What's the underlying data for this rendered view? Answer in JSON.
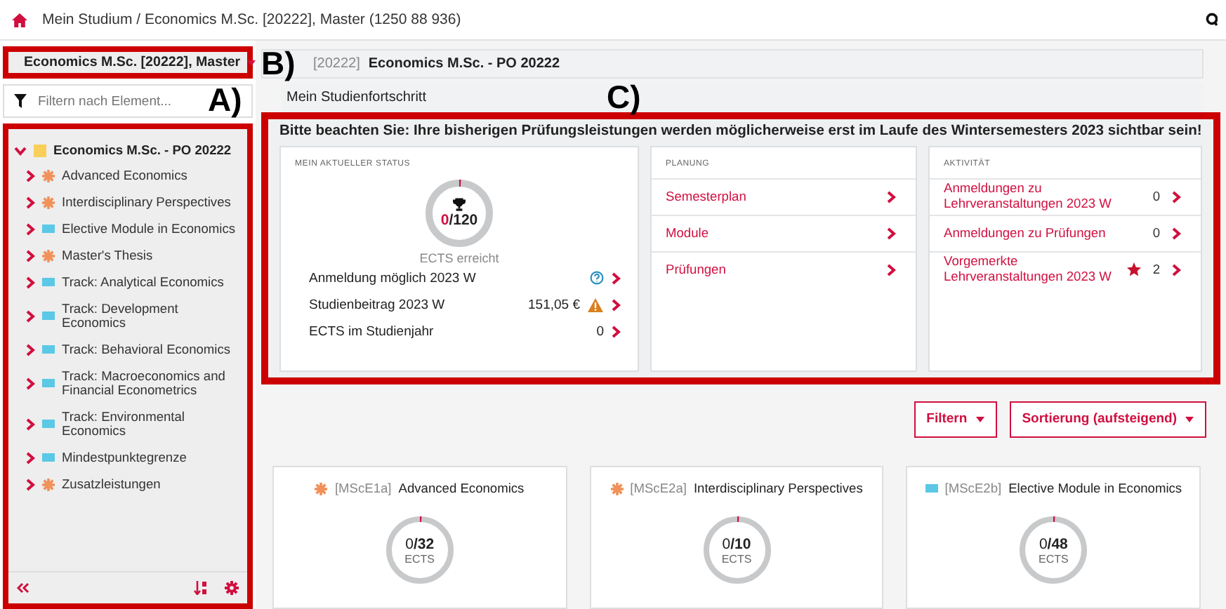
{
  "top_bar": {
    "breadcrumb": "Mein Studium / Economics M.Sc. [20222], Master (1250 88 936)"
  },
  "annotations": [
    {
      "label": "A)"
    },
    {
      "label": "B)"
    },
    {
      "label": "C)"
    }
  ],
  "sidebar": {
    "program_selector": "Economics M.Sc. [20222], Master",
    "filter": {
      "placeholder": "Filtern nach Element..."
    },
    "tree": [
      {
        "label": "Economics M.Sc. - PO 20222",
        "kind": "square",
        "color": "#f9cf5a",
        "expanded": true,
        "children": [
          {
            "label": "Advanced Economics",
            "kind": "gear",
            "color": "#f0925a",
            "expanded": false
          },
          {
            "label": "Interdisciplinary Perspectives",
            "kind": "gear",
            "color": "#f0925a",
            "expanded": false
          },
          {
            "label": "Elective Module in Economics",
            "kind": "bar",
            "color": "#5bc8e6",
            "expanded": false
          },
          {
            "label": "Master's Thesis",
            "kind": "gear",
            "color": "#f0925a",
            "expanded": false
          },
          {
            "label": "Track: Analytical Economics",
            "kind": "bar",
            "color": "#5bc8e6",
            "expanded": false
          },
          {
            "label": "Track: Development Economics",
            "kind": "bar",
            "color": "#5bc8e6",
            "expanded": false
          },
          {
            "label": "Track: Behavioral Economics",
            "kind": "bar",
            "color": "#5bc8e6",
            "expanded": false
          },
          {
            "label": "Track: Macroeconomics and Financial Econometrics",
            "kind": "bar",
            "color": "#5bc8e6",
            "expanded": false
          },
          {
            "label": "Track: Environmental Economics",
            "kind": "bar",
            "color": "#5bc8e6",
            "expanded": false
          },
          {
            "label": "Mindestpunktegrenze",
            "kind": "bar",
            "color": "#5bc8e6",
            "expanded": false
          },
          {
            "label": "Zusatzleistungen",
            "kind": "gear",
            "color": "#f0925a",
            "expanded": false
          }
        ]
      }
    ]
  },
  "header": {
    "code": "[20222]",
    "title": "Economics M.Sc. - PO 20222"
  },
  "progress_title": "Mein Studienfortschritt",
  "notice": "Bitte beachten Sie: Ihre bisherigen Prüfungsleistungen werden möglicherweise erst im Laufe des Wintersemesters 2023 sichtbar sein!",
  "status": {
    "title": "MEIN AKTUELLER STATUS",
    "achieved": "0",
    "total": "/120",
    "caption": "ECTS erreicht",
    "rows": [
      {
        "label": "Anmeldung möglich 2023 W",
        "kind": "help"
      },
      {
        "label": "Studienbeitrag 2023 W",
        "value": "151,05 €",
        "kind": "warning"
      },
      {
        "label": "ECTS im Studienjahr",
        "value": "0",
        "kind": "plain"
      }
    ]
  },
  "planning": {
    "title": "PLANUNG",
    "links": [
      "Semesterplan",
      "Module",
      "Prüfungen"
    ]
  },
  "activity": {
    "title": "AKTIVITÄT",
    "rows": [
      {
        "label": "Anmeldungen zu Lehrveranstaltungen 2023 W",
        "count": "0",
        "starred": false
      },
      {
        "label": "Anmeldungen zu Prüfungen",
        "count": "0",
        "starred": false
      },
      {
        "label": "Vorgemerkte Lehrveranstaltungen 2023 W",
        "count": "2",
        "starred": true
      }
    ]
  },
  "toolbar": {
    "buttons": [
      "Filtern",
      "Sortierung (aufsteigend)"
    ]
  },
  "modules": [
    {
      "code": "[MScE1a]",
      "title": "Advanced Economics",
      "kind": "gear",
      "color": "#f0925a",
      "achieved": "0",
      "total": "/32",
      "unit": "ECTS"
    },
    {
      "code": "[MScE2a]",
      "title": "Interdisciplinary Perspectives",
      "kind": "gear",
      "color": "#f0925a",
      "achieved": "0",
      "total": "/10",
      "unit": "ECTS"
    },
    {
      "code": "[MScE2b]",
      "title": "Elective Module in Economics",
      "kind": "bar",
      "color": "#5bc8e6",
      "achieved": "0",
      "total": "/48",
      "unit": "ECTS"
    }
  ]
}
